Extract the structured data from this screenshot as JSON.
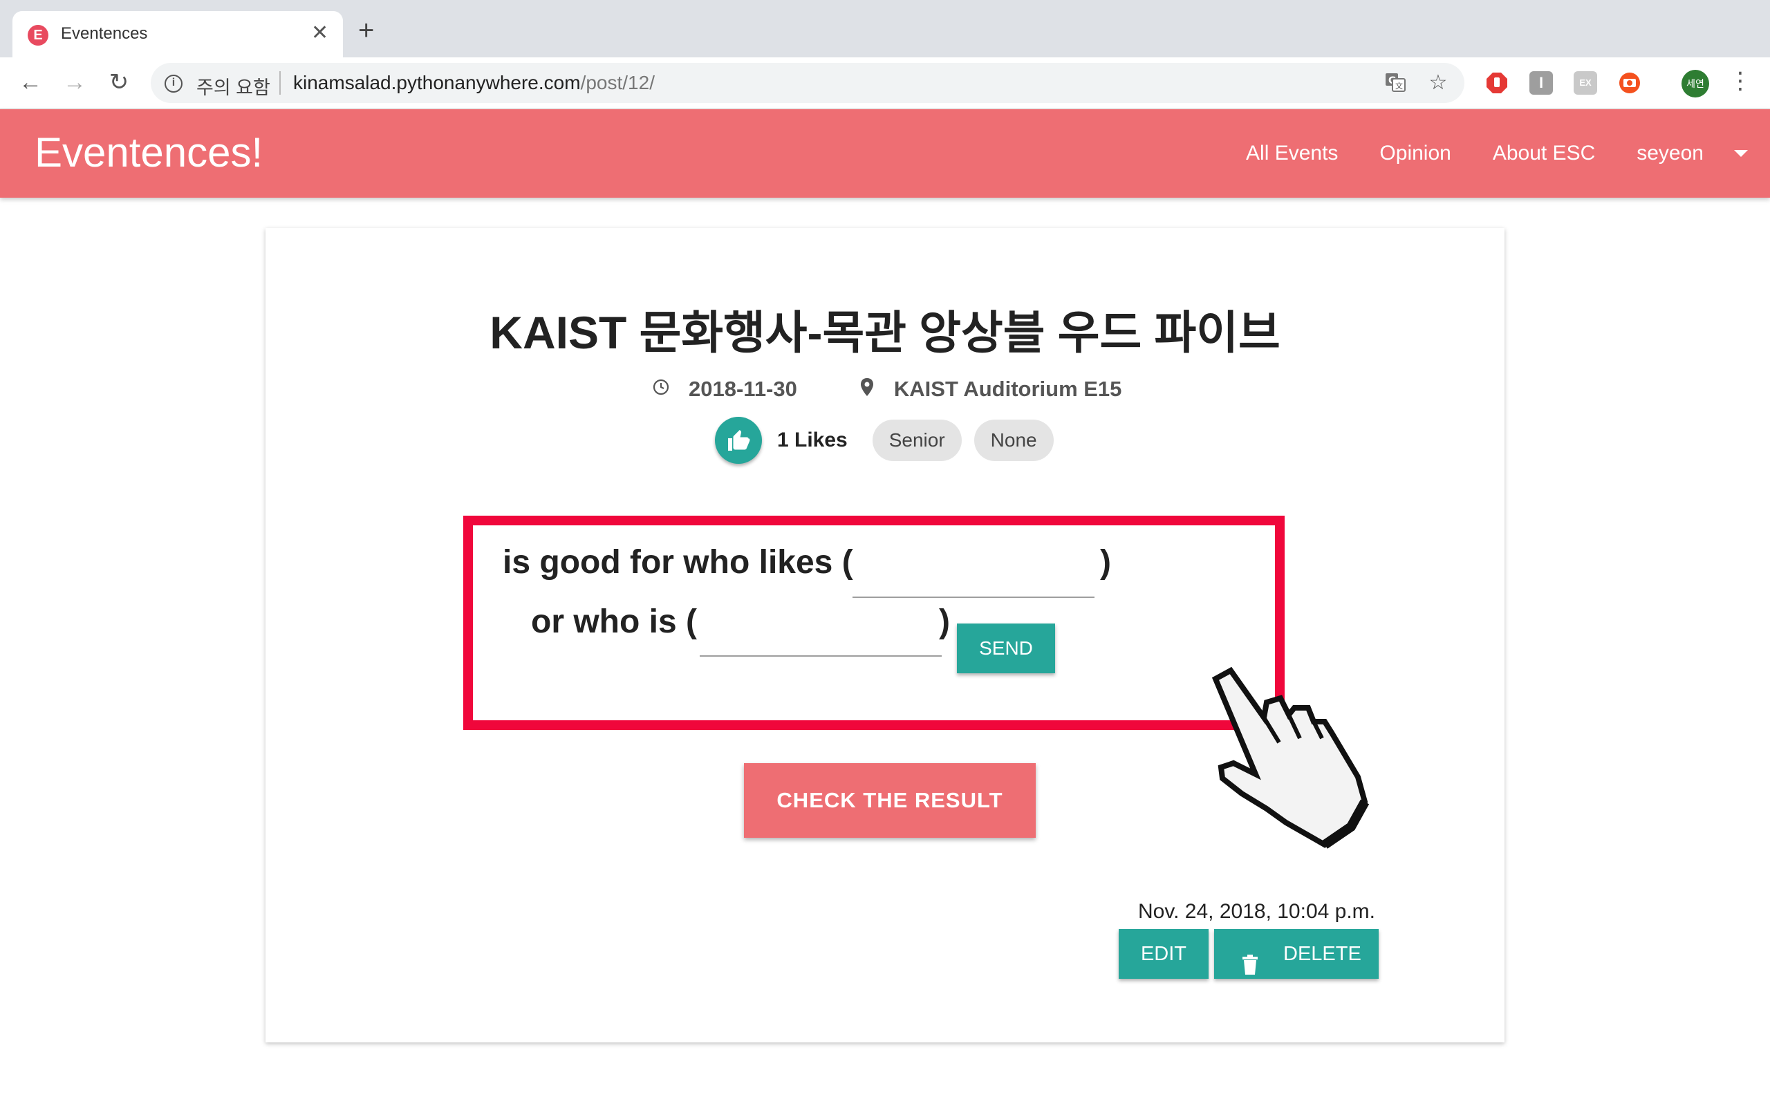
{
  "browser": {
    "tab_title": "Eventences",
    "tab_favicon": "E",
    "security_label": "주의 요함",
    "url_host": "kinamsalad.pythonanywhere.com",
    "url_path": "/post/12/",
    "profile_label": "세연",
    "extensions": [
      "adblock-icon",
      "instapaper-icon",
      "ex-icon",
      "screencast-icon"
    ]
  },
  "navbar": {
    "brand": "Eventences!",
    "links": [
      "All Events",
      "Opinion",
      "About ESC",
      "seyeon"
    ],
    "color": "#ee6e73"
  },
  "post": {
    "title": "KAIST 문화행사-목관 앙상블 우드 파이브",
    "date": "2018-11-30",
    "location": "KAIST Auditorium E15",
    "likes_label": "1 Likes",
    "chips": [
      "Senior",
      "None"
    ]
  },
  "sentence": {
    "line1_prefix": "is good for who likes (",
    "line1_suffix": ")",
    "line2_prefix": "or who is (",
    "line2_suffix": ")",
    "input1_value": "",
    "input2_value": "",
    "send_label": "SEND",
    "highlight_color": "#f0073b"
  },
  "actions": {
    "check_label": "CHECK THE RESULT",
    "timestamp": "Nov. 24, 2018, 10:04 p.m.",
    "edit_label": "EDIT",
    "delete_label": "DELETE",
    "accent": "#26a69a"
  }
}
